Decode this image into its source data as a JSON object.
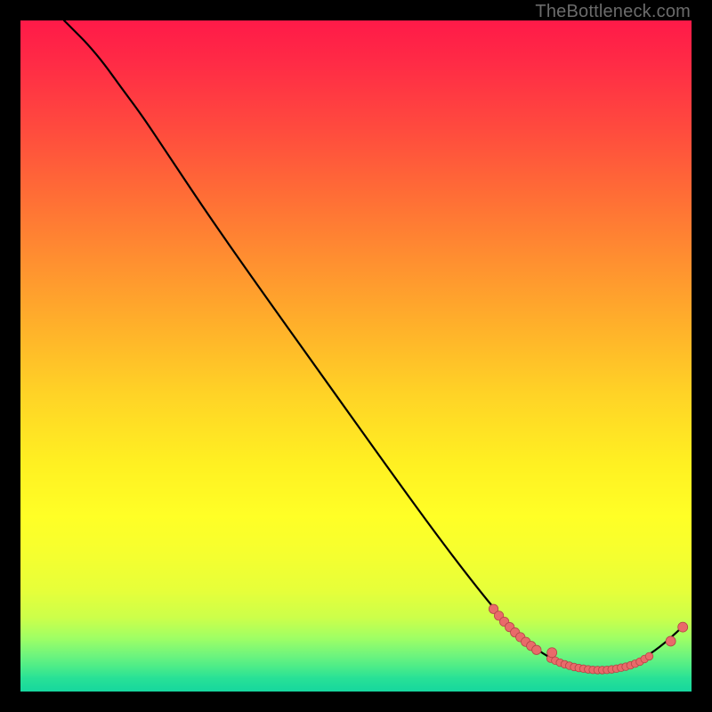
{
  "attribution": "TheBottleneck.com",
  "chart_data": {
    "type": "line",
    "title": "",
    "xlabel": "",
    "ylabel": "",
    "xlim": [
      0,
      100
    ],
    "ylim": [
      0,
      100
    ],
    "grid": false,
    "legend": false,
    "curve": [
      {
        "x": 6.5,
        "y": 100
      },
      {
        "x": 8,
        "y": 98.5
      },
      {
        "x": 10,
        "y": 96.5
      },
      {
        "x": 12.5,
        "y": 93.5
      },
      {
        "x": 15,
        "y": 90
      },
      {
        "x": 18,
        "y": 86
      },
      {
        "x": 22,
        "y": 80
      },
      {
        "x": 28,
        "y": 71
      },
      {
        "x": 35,
        "y": 61
      },
      {
        "x": 45,
        "y": 47
      },
      {
        "x": 55,
        "y": 33
      },
      {
        "x": 63,
        "y": 22
      },
      {
        "x": 70,
        "y": 13
      },
      {
        "x": 74,
        "y": 8.5
      },
      {
        "x": 78,
        "y": 5.5
      },
      {
        "x": 81,
        "y": 4
      },
      {
        "x": 84,
        "y": 3.3
      },
      {
        "x": 87,
        "y": 3.2
      },
      {
        "x": 90,
        "y": 3.7
      },
      {
        "x": 93,
        "y": 5
      },
      {
        "x": 96,
        "y": 7.2
      },
      {
        "x": 98.5,
        "y": 9.5
      }
    ],
    "markers_segment_a": [
      {
        "x": 70.5,
        "y": 12.3
      },
      {
        "x": 71.3,
        "y": 11.3
      },
      {
        "x": 72.1,
        "y": 10.4
      },
      {
        "x": 72.9,
        "y": 9.6
      },
      {
        "x": 73.7,
        "y": 8.8
      },
      {
        "x": 74.5,
        "y": 8.1
      },
      {
        "x": 75.3,
        "y": 7.4
      },
      {
        "x": 76.1,
        "y": 6.8
      },
      {
        "x": 76.9,
        "y": 6.2
      }
    ],
    "markers_segment_b": [
      {
        "x": 79.0,
        "y": 4.9
      },
      {
        "x": 79.7,
        "y": 4.6
      },
      {
        "x": 80.4,
        "y": 4.3
      },
      {
        "x": 81.1,
        "y": 4.05
      },
      {
        "x": 81.8,
        "y": 3.85
      },
      {
        "x": 82.5,
        "y": 3.65
      },
      {
        "x": 83.2,
        "y": 3.5
      },
      {
        "x": 83.9,
        "y": 3.4
      },
      {
        "x": 84.6,
        "y": 3.3
      },
      {
        "x": 85.3,
        "y": 3.22
      },
      {
        "x": 86.0,
        "y": 3.2
      },
      {
        "x": 86.7,
        "y": 3.2
      },
      {
        "x": 87.4,
        "y": 3.22
      },
      {
        "x": 88.1,
        "y": 3.3
      },
      {
        "x": 88.8,
        "y": 3.4
      },
      {
        "x": 89.5,
        "y": 3.55
      },
      {
        "x": 90.2,
        "y": 3.7
      },
      {
        "x": 90.9,
        "y": 3.9
      },
      {
        "x": 91.6,
        "y": 4.15
      },
      {
        "x": 92.3,
        "y": 4.45
      },
      {
        "x": 93.0,
        "y": 4.85
      },
      {
        "x": 93.7,
        "y": 5.25
      }
    ],
    "markers_extra": [
      {
        "x": 79.2,
        "y": 5.8
      },
      {
        "x": 96.9,
        "y": 7.5
      },
      {
        "x": 98.7,
        "y": 9.6
      }
    ],
    "colors": {
      "curve": "#000000",
      "marker_fill": "#e96a6a",
      "marker_stroke": "#b34646"
    }
  }
}
